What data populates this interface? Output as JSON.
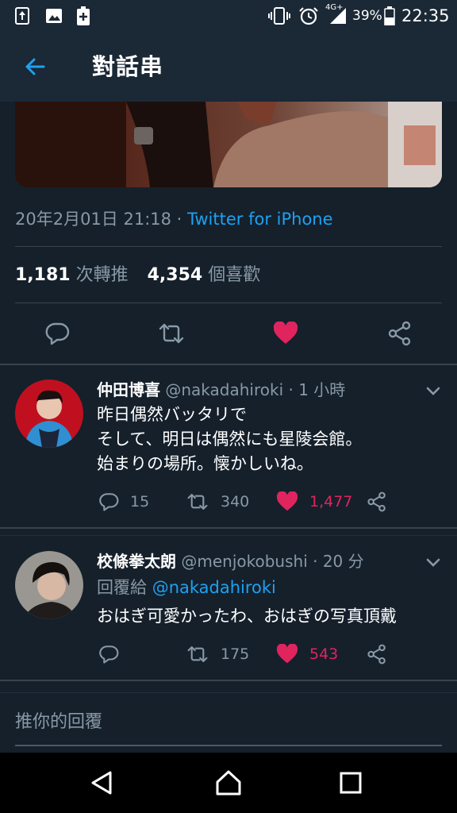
{
  "status_bar": {
    "network": "4G+",
    "battery_percent": "39%",
    "time": "22:35",
    "icons": [
      "upload-sync-icon",
      "image-icon",
      "battery-plus-icon",
      "vibrate-icon",
      "alarm-icon",
      "signal-icon",
      "battery-icon"
    ]
  },
  "header": {
    "title": "對話串",
    "back_icon": "arrow-left-icon"
  },
  "tweet": {
    "timestamp": "20年2月01日 21:18",
    "separator": " · ",
    "source": "Twitter for iPhone",
    "retweet_count": "1,181",
    "retweet_label": "次轉推",
    "like_count": "4,354",
    "like_label": "個喜歡",
    "actions": [
      "reply-icon",
      "retweet-icon",
      "like-icon",
      "share-icon"
    ]
  },
  "replies": [
    {
      "name": "仲田博喜",
      "handle": "@nakadahiroki",
      "time": " · 1 小時",
      "lines": [
        "昨日偶然バッタリで",
        "そして、明日は偶然にも星陵会館。",
        "始まりの場所。懐かしいね。"
      ],
      "reply_count": "15",
      "retweet_count": "340",
      "like_count": "1,477"
    },
    {
      "name": "校條拳太朗",
      "handle": "@menjokobushi",
      "time": " · 20 分",
      "reply_to_label": "回覆給 ",
      "reply_to_handle": "@nakadahiroki",
      "lines": [
        "おはぎ可愛かったわ、おはぎの写真頂戴"
      ],
      "reply_count": "",
      "retweet_count": "175",
      "like_count": "543"
    }
  ],
  "compose": {
    "placeholder": "推你的回覆"
  },
  "colors": {
    "background": "#15202b",
    "bar": "#1b2836",
    "accent": "#1da1f2",
    "like": "#e0245e",
    "secondary_text": "#8899a6"
  }
}
